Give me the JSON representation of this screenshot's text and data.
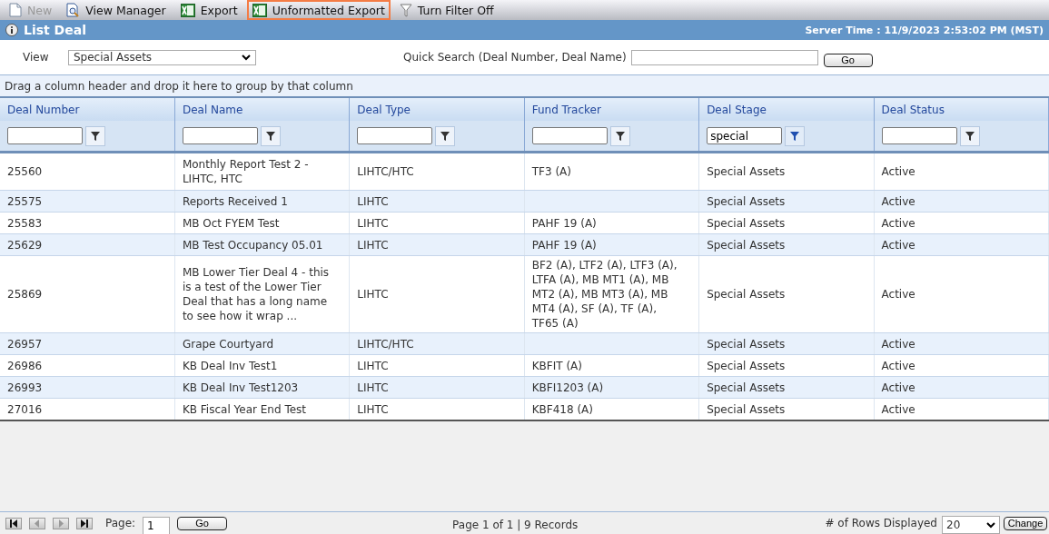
{
  "toolbar": [
    {
      "kind": "new",
      "label": "New",
      "disabled": true,
      "highlighted": false
    },
    {
      "kind": "view-manager",
      "label": "View Manager",
      "disabled": false,
      "highlighted": false
    },
    {
      "kind": "export",
      "label": "Export",
      "disabled": false,
      "highlighted": false
    },
    {
      "kind": "export",
      "label": "Unformatted Export",
      "disabled": false,
      "highlighted": true
    },
    {
      "kind": "filter",
      "label": "Turn Filter Off",
      "disabled": false,
      "highlighted": false
    }
  ],
  "title_bar": {
    "title": "List Deal",
    "server_time": "Server Time : 11/9/2023 2:53:02 PM (MST)"
  },
  "view": {
    "label": "View",
    "value": "Special Assets"
  },
  "quick_search": {
    "label": "Quick Search (Deal Number, Deal Name)",
    "button": "Go"
  },
  "group_panel": "Drag a column header and drop it here to group by that column",
  "table": {
    "columns": [
      {
        "header": "Deal Number",
        "filter_active": false
      },
      {
        "header": "Deal Name",
        "filter_active": false
      },
      {
        "header": "Deal Type",
        "filter_active": false
      },
      {
        "header": "Fund Tracker",
        "filter_active": false
      },
      {
        "header": "Deal Stage",
        "filter": "special",
        "filter_active": true
      },
      {
        "header": "Deal Status",
        "filter_active": false
      }
    ],
    "rows": [
      [
        "25560",
        "Monthly Report Test 2 - LIHTC, HTC",
        "LIHTC/HTC",
        "TF3 (A)",
        "Special Assets",
        "Active"
      ],
      [
        "25575",
        "Reports Received 1",
        "LIHTC",
        "",
        "Special Assets",
        "Active"
      ],
      [
        "25583",
        "MB Oct FYEM Test",
        "LIHTC",
        "PAHF 19 (A)",
        "Special Assets",
        "Active"
      ],
      [
        "25629",
        "MB Test Occupancy 05.01",
        "LIHTC",
        "PAHF 19 (A)",
        "Special Assets",
        "Active"
      ],
      [
        "25869",
        "MB Lower Tier Deal 4 - this is a test of the Lower Tier Deal that has a long name to see how it wrap ...",
        "LIHTC",
        "BF2 (A), LTF2 (A), LTF3 (A), LTFA (A), MB MT1 (A), MB MT2 (A), MB MT3 (A), MB MT4 (A), SF (A), TF (A), TF65 (A)",
        "Special Assets",
        "Active"
      ],
      [
        "26957",
        "Grape Courtyard",
        "LIHTC/HTC",
        "",
        "Special Assets",
        "Active"
      ],
      [
        "26986",
        "KB Deal Inv Test1",
        "LIHTC",
        "KBFIT (A)",
        "Special Assets",
        "Active"
      ],
      [
        "26993",
        "KB Deal Inv Test1203",
        "LIHTC",
        "KBFI1203 (A)",
        "Special Assets",
        "Active"
      ],
      [
        "27016",
        "KB Fiscal Year End Test",
        "LIHTC",
        "KBF418 (A)",
        "Special Assets",
        "Active"
      ]
    ]
  },
  "pager": {
    "buttons": [
      {
        "kind": "first",
        "disabled": false
      },
      {
        "kind": "prev",
        "disabled": true
      },
      {
        "kind": "next",
        "disabled": true
      },
      {
        "kind": "last",
        "disabled": false
      }
    ],
    "page_label": "Page:",
    "page_value": "1",
    "go": "Go",
    "info": "Page 1 of 1 | 9 Records",
    "rows_label": "# of Rows Displayed",
    "rows_value": "20",
    "change": "Change"
  }
}
